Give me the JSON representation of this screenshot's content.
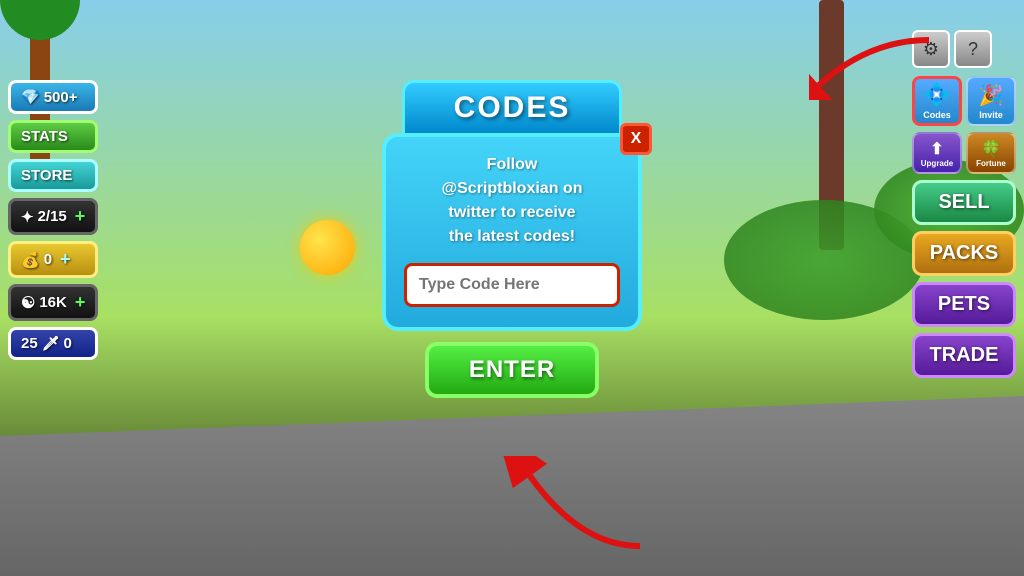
{
  "background": {
    "sky_color": "#87CEEB",
    "grass_color": "#a8e063"
  },
  "modal": {
    "title": "CODES",
    "close_label": "X",
    "description_line1": "Follow",
    "description_line2": "@Scriptbloxian on",
    "description_line3": "twitter to receive",
    "description_line4": "the latest codes!",
    "input_placeholder": "Type Code Here",
    "enter_button_label": "ENTER"
  },
  "left_panel": {
    "gem_count": "500+",
    "stats_label": "STATS",
    "store_label": "STORE",
    "stars_label": "2/15",
    "stars_plus": "+",
    "coins_label": "0",
    "coins_plus": "+",
    "yin_count": "16K",
    "yin_plus": "+",
    "sword_count": "25",
    "sword_val": "0"
  },
  "right_panel": {
    "gear_icon": "⚙",
    "question_icon": "?",
    "codes_label": "Codes",
    "invite_label": "Invite",
    "upgrade_label": "Upgrade",
    "fortune_label": "Fortune",
    "sell_label": "SELL",
    "packs_label": "PACKS",
    "pets_label": "PETS",
    "trade_label": "TRADE"
  },
  "colors": {
    "codes_title_bg": "#33ccff",
    "modal_bg": "#44d4f8",
    "enter_btn": "#55ee44",
    "close_btn": "#cc2200",
    "input_border": "#cc2200"
  }
}
